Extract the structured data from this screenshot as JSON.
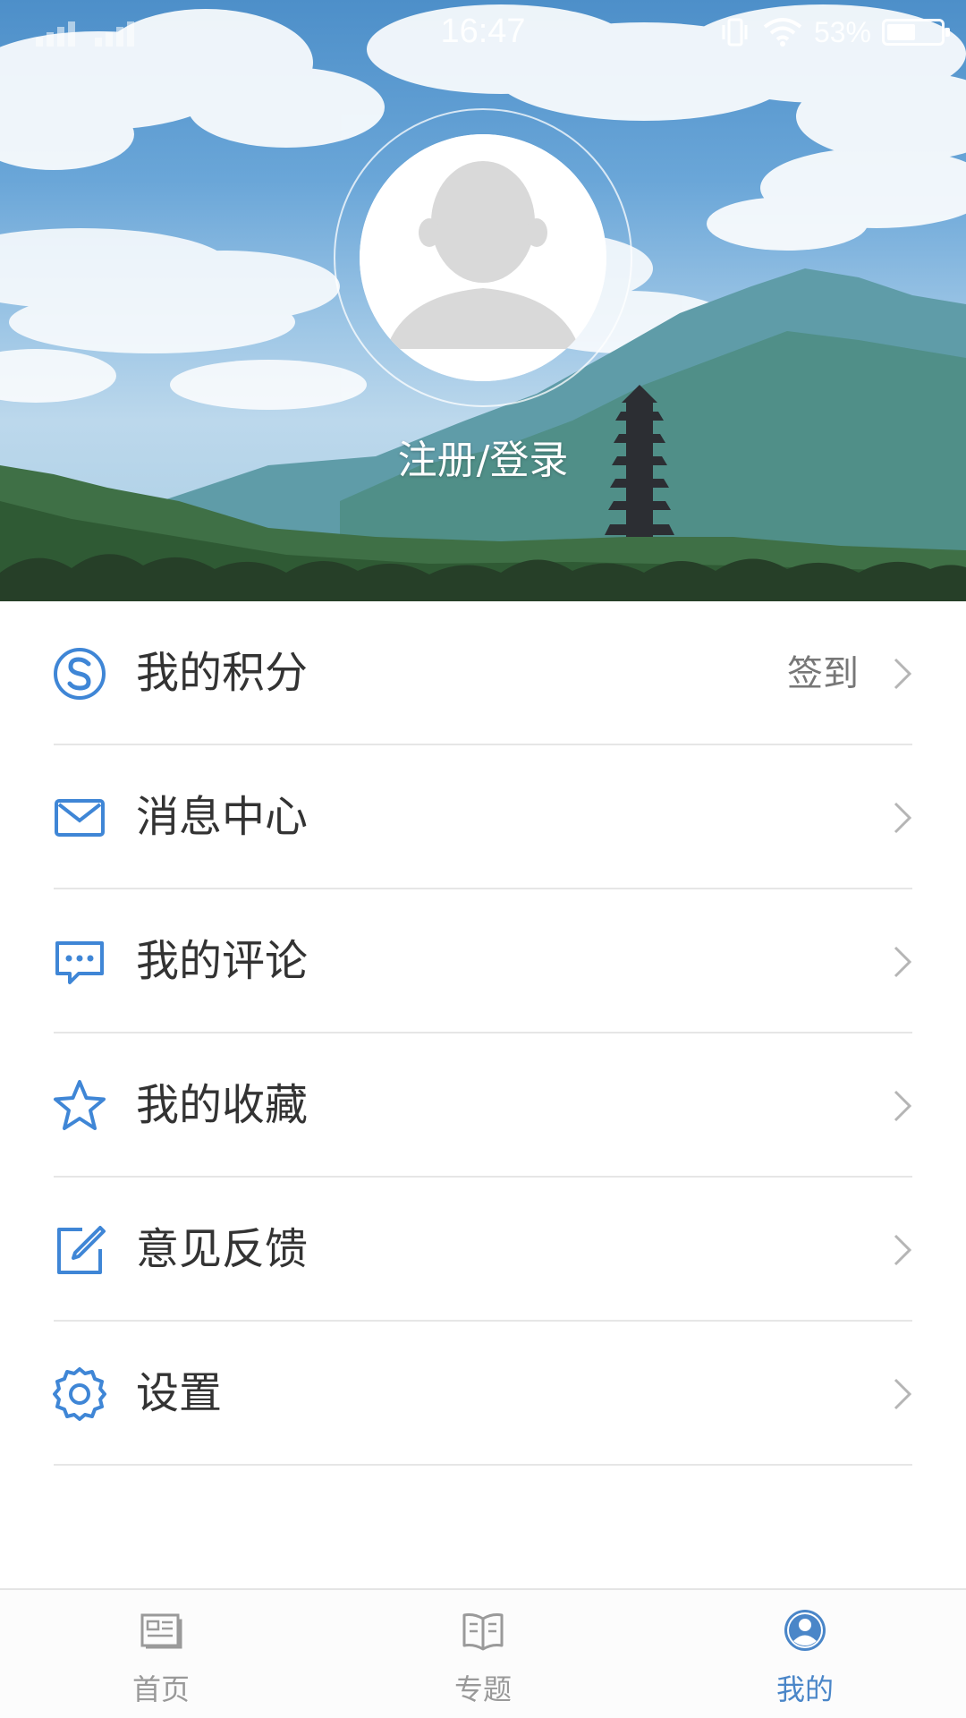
{
  "status_bar": {
    "time": "16:47",
    "battery_percent": "53%",
    "battery_level": 0.53,
    "icons": [
      "signal-icon",
      "vibrate-icon",
      "wifi-icon",
      "battery-icon"
    ]
  },
  "profile": {
    "login_label": "注册/登录"
  },
  "menu": {
    "items": [
      {
        "label": "我的积分",
        "icon": "points-icon",
        "right_text": "签到"
      },
      {
        "label": "消息中心",
        "icon": "mail-icon"
      },
      {
        "label": "我的评论",
        "icon": "comment-icon"
      },
      {
        "label": "我的收藏",
        "icon": "star-icon"
      },
      {
        "label": "意见反馈",
        "icon": "feedback-icon"
      },
      {
        "label": "设置",
        "icon": "gear-icon"
      }
    ]
  },
  "tabbar": {
    "tabs": [
      {
        "label": "首页",
        "icon": "newspaper-icon",
        "active": false
      },
      {
        "label": "专题",
        "icon": "book-icon",
        "active": false
      },
      {
        "label": "我的",
        "icon": "user-icon",
        "active": true
      }
    ]
  },
  "colors": {
    "accent": "#4a86c8",
    "icon_blue": "#3f86d6",
    "text": "#333333",
    "muted": "#999999",
    "divider": "#e6e6e6"
  }
}
